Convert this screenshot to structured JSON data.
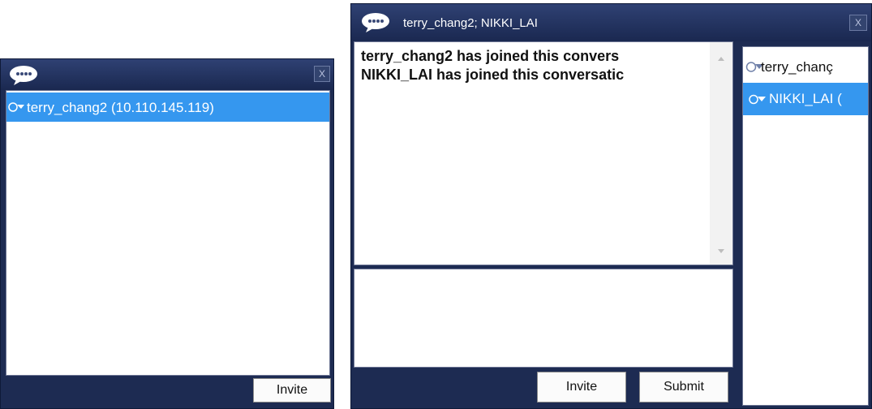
{
  "invite_window": {
    "users": [
      {
        "name": "terry_chang2 (10.110.145.119)",
        "selected": true
      }
    ],
    "invite_label": "Invite"
  },
  "chat_window": {
    "title": "terry_chang2; NIKKI_LAI",
    "close_label": "X",
    "messages": [
      "terry_chang2 has joined this convers",
      "NIKKI_LAI has joined this conversatic"
    ],
    "participants": [
      {
        "name": "terry_chanç",
        "selected": false
      },
      {
        "name": "NIKKI_LAI (",
        "selected": true
      }
    ],
    "invite_label": "Invite",
    "submit_label": "Submit"
  },
  "colors": {
    "window_frame": "#1d2b52",
    "selection": "#3597ef"
  }
}
